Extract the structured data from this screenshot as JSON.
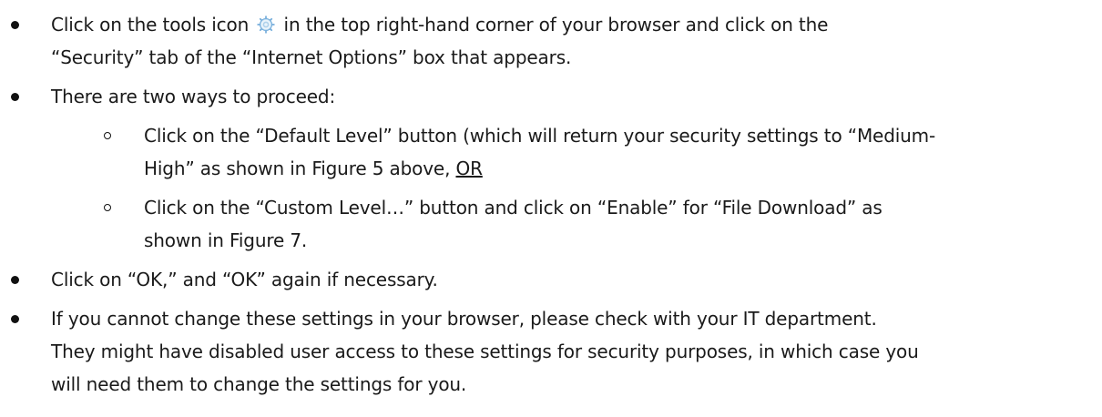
{
  "items": [
    {
      "line1_before_icon": "Click on the tools icon ",
      "icon": "gear-icon",
      "line1_after_icon": " in the top right-hand corner of your browser and click on the",
      "line2": "“Security” tab of the “Internet Options” box that appears."
    },
    {
      "line1": "There are two ways to proceed:",
      "subitems": [
        {
          "line1": "Click on the “Default Level” button (which will return your security settings to “Medium-",
          "line2_before_or": "High” as shown in Figure 5 above, ",
          "line2_or": "OR"
        },
        {
          "line1": "Click on the “Custom Level…” button and click on “Enable” for “File Download” as",
          "line2": "shown in Figure 7."
        }
      ]
    },
    {
      "line1": "Click on “OK,” and “OK” again if necessary."
    },
    {
      "line1": "If you cannot change these settings in your browser, please check with your IT department.",
      "line2": "They might have disabled user access to these settings for security purposes, in which case you",
      "line3": "will need them to change the settings for you."
    }
  ],
  "colors": {
    "text": "#1a1a1a",
    "gear_icon": "#6aa7d8"
  }
}
